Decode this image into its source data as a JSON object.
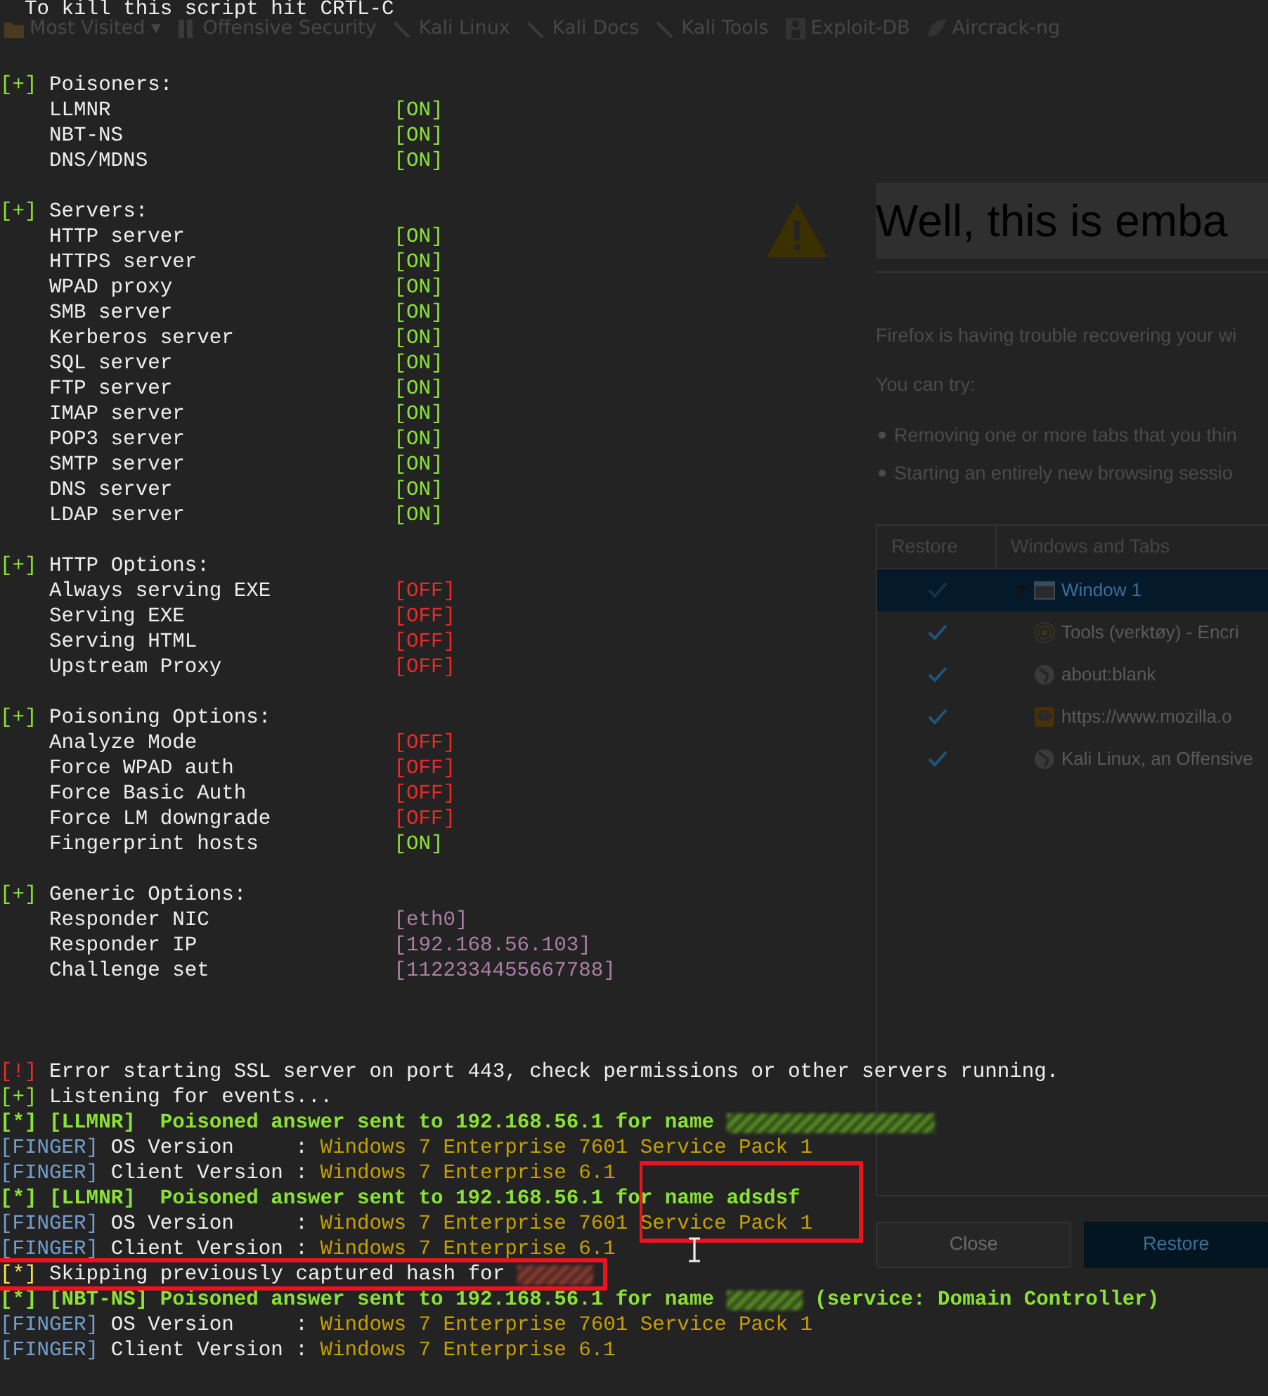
{
  "browser": {
    "bookmarks": [
      {
        "kind": "folder",
        "label": "Most Visited",
        "dropdown": "▾"
      },
      {
        "kind": "bars",
        "label": "Offensive Security"
      },
      {
        "kind": "swoosh",
        "label": "Kali Linux"
      },
      {
        "kind": "swoosh",
        "label": "Kali Docs"
      },
      {
        "kind": "swoosh",
        "label": "Kali Tools"
      },
      {
        "kind": "figure",
        "label": "Exploit-DB"
      },
      {
        "kind": "leaf",
        "label": "Aircrack-ng"
      }
    ],
    "page": {
      "title": "Well, this is emba",
      "message": "Firefox is having trouble recovering your wi",
      "try_label": "You can try:",
      "suggestions": [
        "Removing one or more tabs that you thin",
        "Starting an entirely new browsing sessio"
      ],
      "table": {
        "columns": [
          "Restore",
          "Windows and Tabs"
        ],
        "windows": [
          {
            "label": "Window 1",
            "kind": "window",
            "checked": true,
            "selected": true,
            "expanded": true,
            "children": [
              {
                "label": "Tools (verktøy) - Encri",
                "kind": "target",
                "checked": true,
                "selected": false
              },
              {
                "label": "about:blank",
                "kind": "globe",
                "checked": true,
                "selected": false
              },
              {
                "label": "https://www.mozilla.o",
                "kind": "alert",
                "checked": true,
                "selected": false
              },
              {
                "label": "Kali Linux, an Offensive",
                "kind": "globe",
                "checked": true,
                "selected": false
              }
            ]
          }
        ]
      },
      "buttons": [
        {
          "label": "Close",
          "kind": "secondary"
        },
        {
          "label": "Restore",
          "kind": "primary"
        }
      ]
    }
  },
  "terminal": {
    "header": "To kill this script hit CRTL-C",
    "sections": [
      {
        "marker": "[+]",
        "title": "Poisoners:",
        "options": [
          {
            "label": "LLMNR",
            "kind": "toggle",
            "value": "[ON]",
            "on": true
          },
          {
            "label": "NBT-NS",
            "kind": "toggle",
            "value": "[ON]",
            "on": true
          },
          {
            "label": "DNS/MDNS",
            "kind": "toggle",
            "value": "[ON]",
            "on": true
          }
        ]
      },
      {
        "marker": "[+]",
        "title": "Servers:",
        "options": [
          {
            "label": "HTTP server",
            "kind": "toggle",
            "value": "[ON]",
            "on": true
          },
          {
            "label": "HTTPS server",
            "kind": "toggle",
            "value": "[ON]",
            "on": true
          },
          {
            "label": "WPAD proxy",
            "kind": "toggle",
            "value": "[ON]",
            "on": true
          },
          {
            "label": "SMB server",
            "kind": "toggle",
            "value": "[ON]",
            "on": true
          },
          {
            "label": "Kerberos server",
            "kind": "toggle",
            "value": "[ON]",
            "on": true
          },
          {
            "label": "SQL server",
            "kind": "toggle",
            "value": "[ON]",
            "on": true
          },
          {
            "label": "FTP server",
            "kind": "toggle",
            "value": "[ON]",
            "on": true
          },
          {
            "label": "IMAP server",
            "kind": "toggle",
            "value": "[ON]",
            "on": true
          },
          {
            "label": "POP3 server",
            "kind": "toggle",
            "value": "[ON]",
            "on": true
          },
          {
            "label": "SMTP server",
            "kind": "toggle",
            "value": "[ON]",
            "on": true
          },
          {
            "label": "DNS server",
            "kind": "toggle",
            "value": "[ON]",
            "on": true
          },
          {
            "label": "LDAP server",
            "kind": "toggle",
            "value": "[ON]",
            "on": true
          }
        ]
      },
      {
        "marker": "[+]",
        "title": "HTTP Options:",
        "options": [
          {
            "label": "Always serving EXE",
            "kind": "toggle",
            "value": "[OFF]",
            "on": false
          },
          {
            "label": "Serving EXE",
            "kind": "toggle",
            "value": "[OFF]",
            "on": false
          },
          {
            "label": "Serving HTML",
            "kind": "toggle",
            "value": "[OFF]",
            "on": false
          },
          {
            "label": "Upstream Proxy",
            "kind": "toggle",
            "value": "[OFF]",
            "on": false
          }
        ]
      },
      {
        "marker": "[+]",
        "title": "Poisoning Options:",
        "options": [
          {
            "label": "Analyze Mode",
            "kind": "toggle",
            "value": "[OFF]",
            "on": false
          },
          {
            "label": "Force WPAD auth",
            "kind": "toggle",
            "value": "[OFF]",
            "on": false
          },
          {
            "label": "Force Basic Auth",
            "kind": "toggle",
            "value": "[OFF]",
            "on": false
          },
          {
            "label": "Force LM downgrade",
            "kind": "toggle",
            "value": "[OFF]",
            "on": false
          },
          {
            "label": "Fingerprint hosts",
            "kind": "toggle",
            "value": "[ON]",
            "on": true
          }
        ]
      },
      {
        "marker": "[+]",
        "title": "Generic Options:",
        "options": [
          {
            "label": "Responder NIC",
            "kind": "setting",
            "value": "[eth0]"
          },
          {
            "label": "Responder IP",
            "kind": "setting",
            "value": "[192.168.56.103]"
          },
          {
            "label": "Challenge set",
            "kind": "setting",
            "value": "[1122334455667788]"
          }
        ]
      }
    ],
    "log": [
      {
        "kind": "error",
        "tag": "[!]",
        "text": "Error starting SSL server on port 443, check permissions or other servers running."
      },
      {
        "kind": "info",
        "tag": "[+]",
        "text": "Listening for events..."
      },
      {
        "kind": "poison",
        "tag": "[*]",
        "text": "[LLMNR]  Poisoned answer sent to 192.168.56.1 for name",
        "redacted": true
      },
      {
        "kind": "finger",
        "tag": "[FINGER]",
        "text": "OS Version     :",
        "value": "Windows 7 Enterprise 7601 Service Pack 1"
      },
      {
        "kind": "finger",
        "tag": "[FINGER]",
        "text": "Client Version :",
        "value": "Windows 7 Enterprise 6.1"
      },
      {
        "kind": "poison",
        "tag": "[*]",
        "text": "[LLMNR]  Poisoned answer sent to 192.168.56.1 for name adsdsf",
        "redacted": false
      },
      {
        "kind": "finger",
        "tag": "[FINGER]",
        "text": "OS Version     :",
        "value": "Windows 7 Enterprise 7601 Service Pack 1"
      },
      {
        "kind": "finger",
        "tag": "[FINGER]",
        "text": "Client Version :",
        "value": "Windows 7 Enterprise 6.1"
      },
      {
        "kind": "notice",
        "tag": "[*]",
        "text": "Skipping previously captured hash for",
        "redacted": true
      },
      {
        "kind": "poison",
        "tag": "[*]",
        "text": "[NBT-NS] Poisoned answer sent to 192.168.56.1 for name",
        "redacted": true,
        "suffix": "(service: Domain Controller)"
      },
      {
        "kind": "finger",
        "tag": "[FINGER]",
        "text": "OS Version     :",
        "value": "Windows 7 Enterprise 7601 Service Pack 1"
      },
      {
        "kind": "finger",
        "tag": "[FINGER]",
        "text": "Client Version :",
        "value": "Windows 7 Enterprise 6.1"
      }
    ]
  }
}
